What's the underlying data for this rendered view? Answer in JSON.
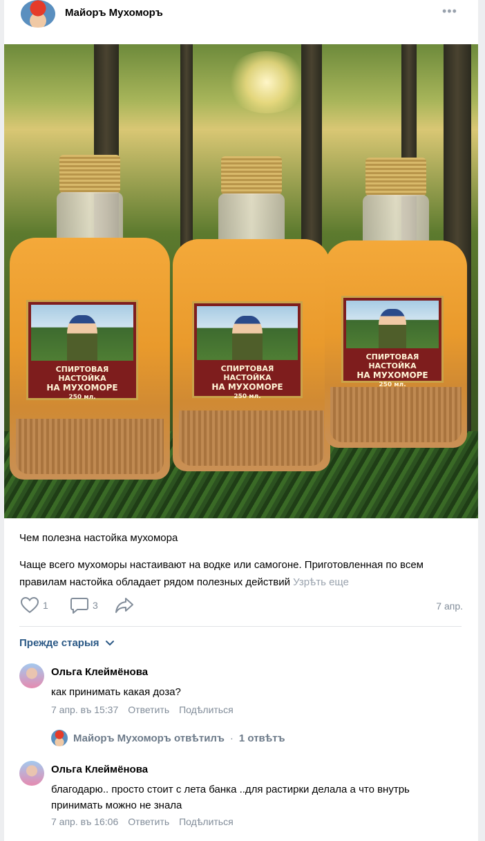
{
  "post": {
    "author": "Майоръ Мухоморъ",
    "menu_icon": "more-dots-icon",
    "image": {
      "bottle_label_line1": "СПИРТОВАЯ НАСТОЙКА",
      "bottle_label_line2": "НА МУХОМОРЕ",
      "bottle_label_volume": "250 мл."
    },
    "title": "Чем полезна настойка мухомора",
    "text": "Чаще всего мухоморы настаивают на водке или самогоне. Приготовленная по всем правилам настойка обладает рядом полезных действий",
    "more": "Узрѣть еще",
    "likes": "1",
    "comments": "3",
    "date": "7 апр."
  },
  "sort": {
    "label": "Прежде старыя"
  },
  "comments": [
    {
      "author": "Ольга Клеймёнова",
      "text": "как принимать какая доза?",
      "time": "7 апр. въ 15:37",
      "reply_label": "Ответить",
      "share_label": "Подѣлиться"
    },
    {
      "author": "Ольга Клеймёнова",
      "text": "благодарю.. просто стоит с лета банка ..для растирки делала а что внутрь принимать можно не знала",
      "time": "7 апр. въ 16:06",
      "reply_label": "Ответить",
      "share_label": "Подѣлиться"
    }
  ],
  "reply_thread": {
    "author": "Майоръ Мухоморъ отвѣтилъ",
    "separator": "·",
    "count": "1 отвѣтъ"
  },
  "colors": {
    "link": "#2a5885",
    "muted": "#818c99",
    "background": "#edeef0"
  }
}
